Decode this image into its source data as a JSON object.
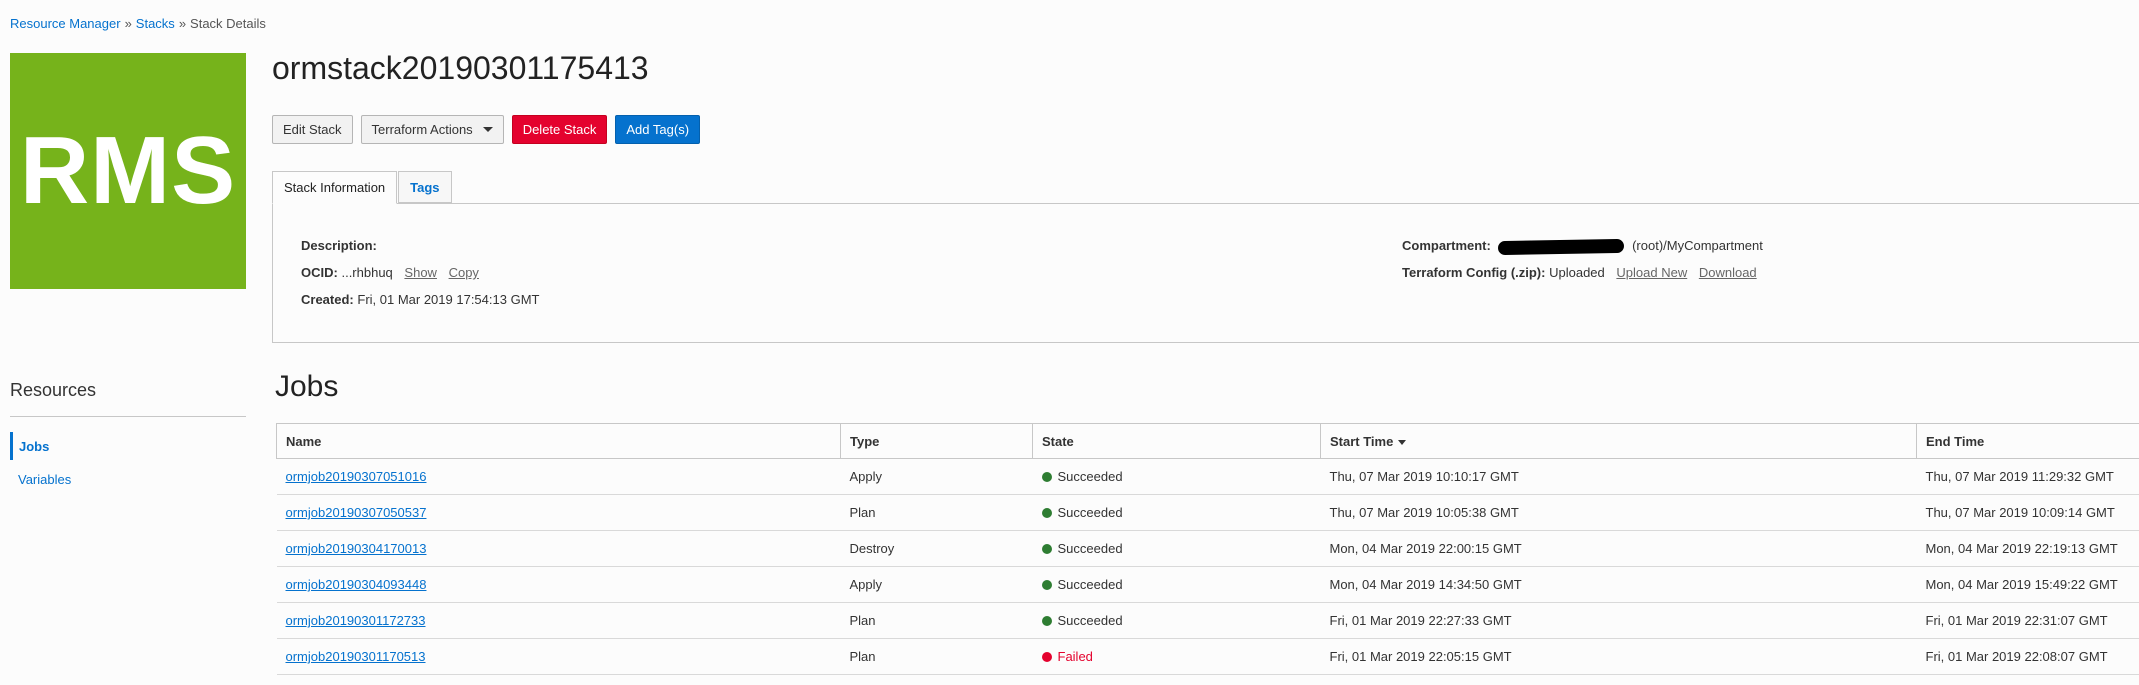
{
  "breadcrumb": {
    "items": [
      "Resource Manager",
      "Stacks"
    ],
    "current": "Stack Details",
    "separator": "»"
  },
  "logo": {
    "text": "RMS"
  },
  "page_title": "ormstack20190301175413",
  "actions": {
    "edit": "Edit Stack",
    "terraform": "Terraform Actions",
    "delete": "Delete Stack",
    "add_tags": "Add Tag(s)"
  },
  "tabs": [
    {
      "label": "Stack Information",
      "active": true
    },
    {
      "label": "Tags",
      "active": false
    }
  ],
  "stack_info": {
    "description_label": "Description:",
    "description_value": "",
    "ocid_label": "OCID:",
    "ocid_value": "...rhbhuq",
    "ocid_show": "Show",
    "ocid_copy": "Copy",
    "created_label": "Created:",
    "created_value": "Fri, 01 Mar 2019 17:54:13 GMT",
    "compartment_label": "Compartment:",
    "compartment_value": "(root)/MyCompartment",
    "config_label": "Terraform Config (.zip):",
    "config_value": "Uploaded",
    "config_upload": "Upload New",
    "config_download": "Download"
  },
  "resources": {
    "title": "Resources",
    "items": [
      "Jobs",
      "Variables"
    ]
  },
  "jobs": {
    "title": "Jobs",
    "columns": [
      "Name",
      "Type",
      "State",
      "Start Time",
      "End Time"
    ],
    "rows": [
      {
        "name": "ormjob20190307051016",
        "type": "Apply",
        "state": "Succeeded",
        "start": "Thu, 07 Mar 2019 10:10:17 GMT",
        "end": "Thu, 07 Mar 2019 11:29:32 GMT"
      },
      {
        "name": "ormjob20190307050537",
        "type": "Plan",
        "state": "Succeeded",
        "start": "Thu, 07 Mar 2019 10:05:38 GMT",
        "end": "Thu, 07 Mar 2019 10:09:14 GMT"
      },
      {
        "name": "ormjob20190304170013",
        "type": "Destroy",
        "state": "Succeeded",
        "start": "Mon, 04 Mar 2019 22:00:15 GMT",
        "end": "Mon, 04 Mar 2019 22:19:13 GMT"
      },
      {
        "name": "ormjob20190304093448",
        "type": "Apply",
        "state": "Succeeded",
        "start": "Mon, 04 Mar 2019 14:34:50 GMT",
        "end": "Mon, 04 Mar 2019 15:49:22 GMT"
      },
      {
        "name": "ormjob20190301172733",
        "type": "Plan",
        "state": "Succeeded",
        "start": "Fri, 01 Mar 2019 22:27:33 GMT",
        "end": "Fri, 01 Mar 2019 22:31:07 GMT"
      },
      {
        "name": "ormjob20190301170513",
        "type": "Plan",
        "state": "Failed",
        "start": "Fri, 01 Mar 2019 22:05:15 GMT",
        "end": "Fri, 01 Mar 2019 22:08:07 GMT"
      }
    ]
  },
  "colors": {
    "link": "#0572ce",
    "danger": "#e4022e",
    "success": "#2e7d32",
    "logo_bg": "#76b31b"
  }
}
